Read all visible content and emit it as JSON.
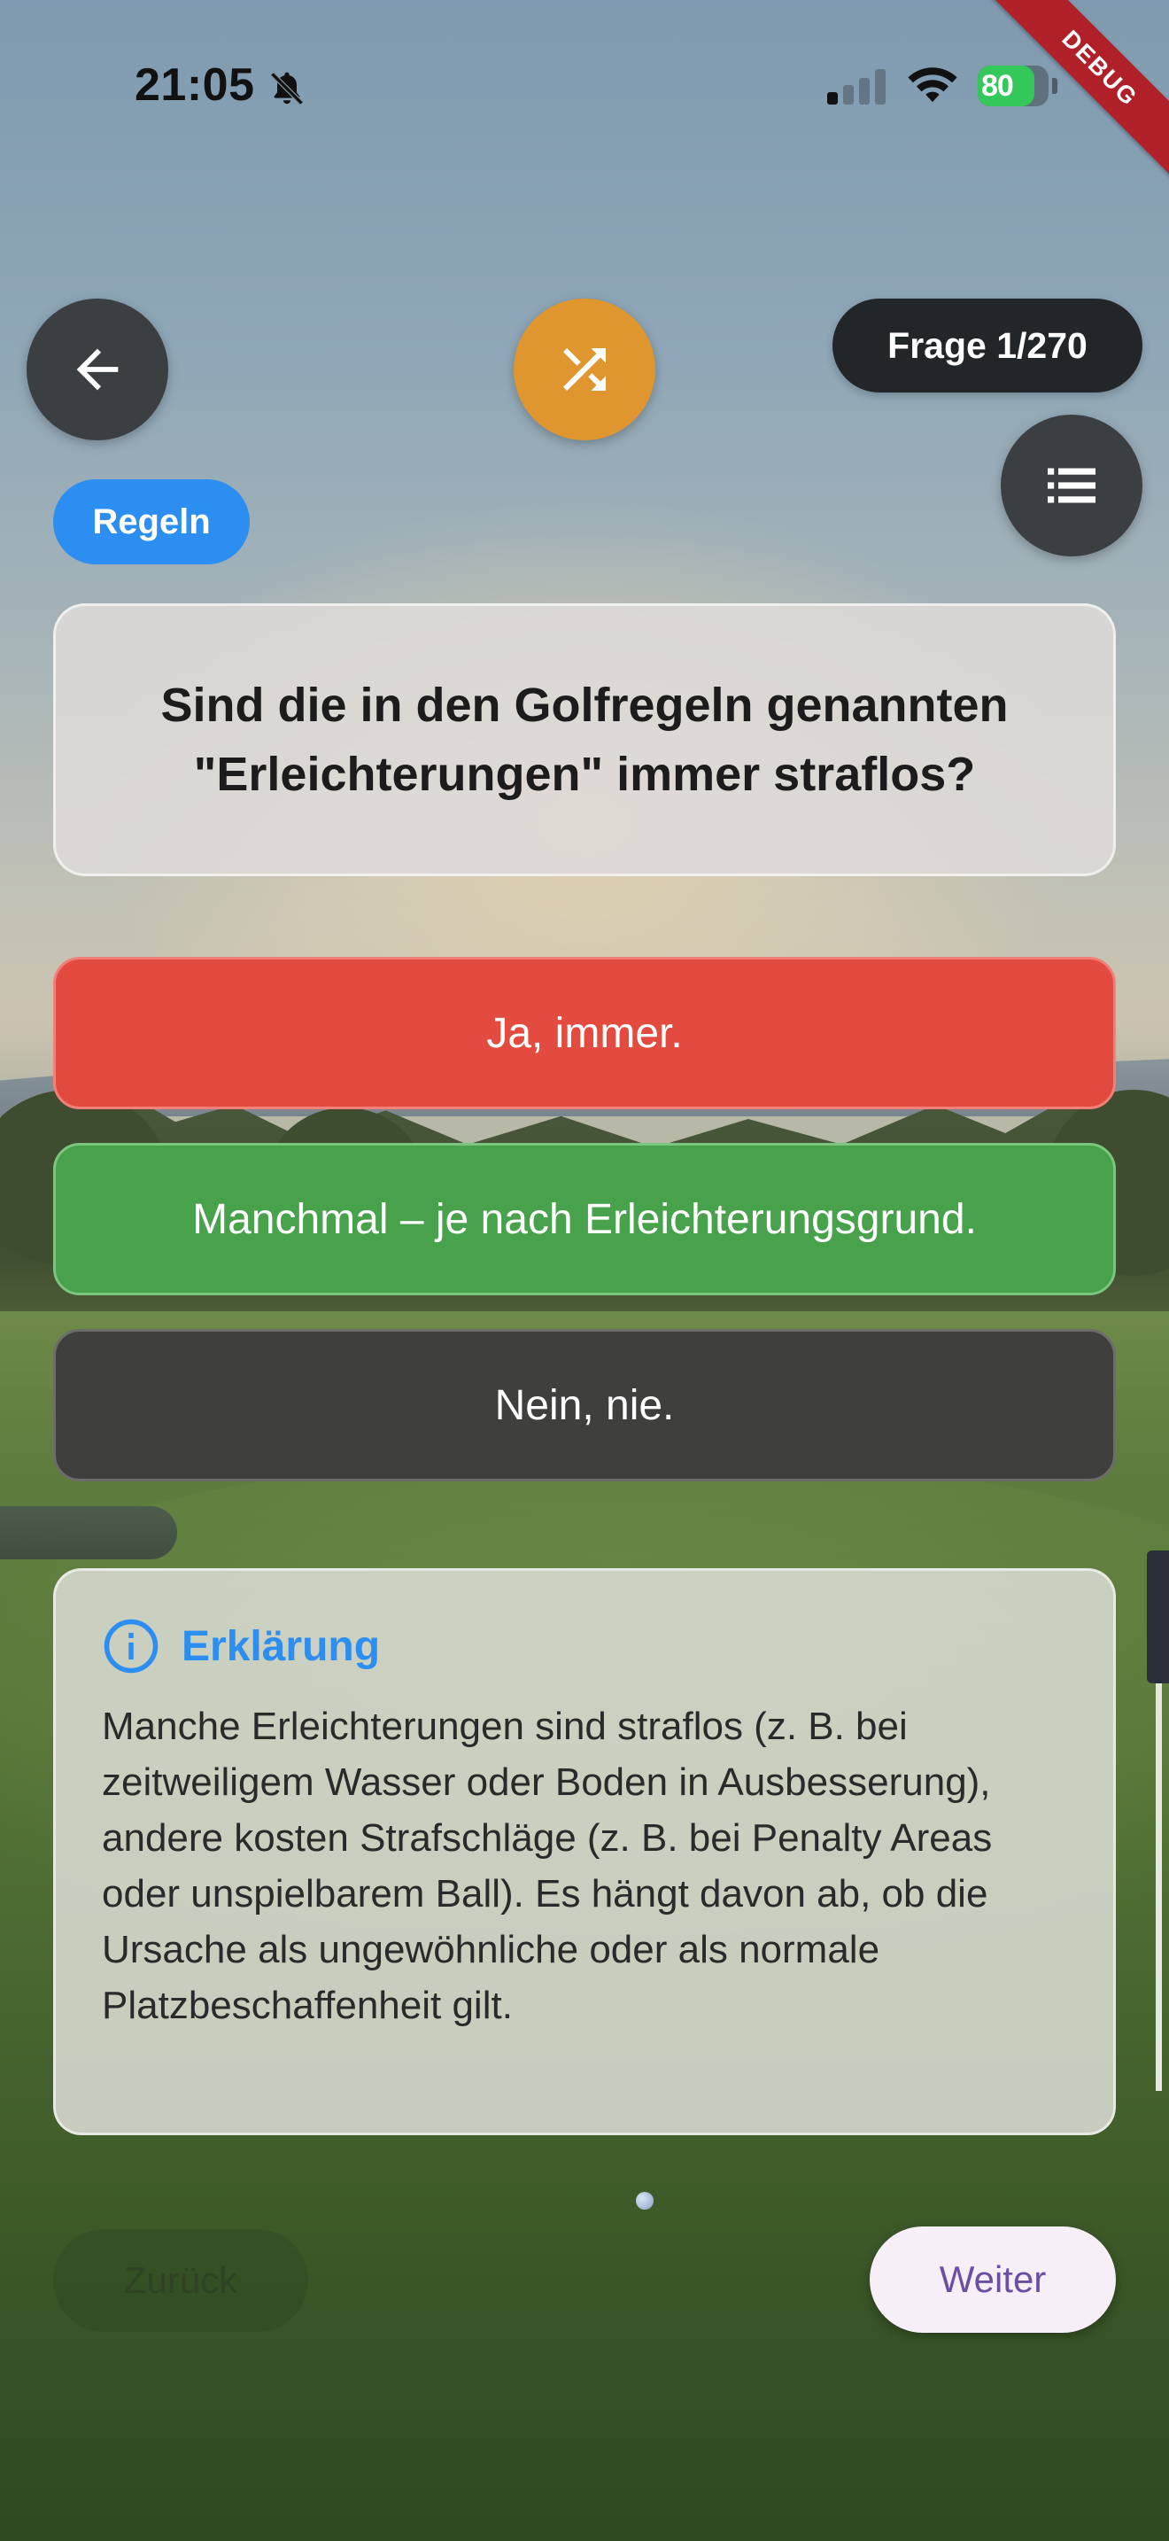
{
  "status_bar": {
    "time": "21:05",
    "battery_level": "80",
    "battery_fraction": 0.8,
    "battery_color": "#34c759",
    "icons": [
      "bell-slash-icon",
      "cellular-signal-icon",
      "wifi-icon",
      "battery-charging-icon"
    ]
  },
  "debug_banner": "DEBUG",
  "header": {
    "back_icon": "arrow-left-icon",
    "shuffle_icon": "shuffle-icon",
    "list_icon": "list-icon",
    "counter": "Frage 1/270",
    "category": "Regeln"
  },
  "question": {
    "text": "Sind die in den Golfregeln genannten \"Erleichterungen\" immer straflos?"
  },
  "answers": [
    {
      "label": "Ja, immer.",
      "state": "wrong"
    },
    {
      "label": "Manchmal – je nach Erleichterungsgrund.",
      "state": "correct"
    },
    {
      "label": "Nein, nie.",
      "state": "neutral"
    }
  ],
  "explanation": {
    "icon": "info-icon",
    "title": "Erklärung",
    "text": "Manche Erleichterungen sind straflos (z. B. bei zeitweiligem Wasser oder Boden in Ausbesserung), andere kosten Strafschläge (z. B. bei Penalty Areas oder unspielbarem Ball). Es hängt davon ab, ob die Ursache als ungewöhnliche oder als normale Platzbeschaffenheit gilt."
  },
  "navigation": {
    "prev_label": "Zurück",
    "next_label": "Weiter"
  },
  "colors": {
    "accent_blue": "#2b8ef0",
    "shuffle_orange": "#e0962e",
    "wrong_red": "#e34b41",
    "correct_green": "#48a14b",
    "next_text_purple": "#6a4fa3"
  }
}
